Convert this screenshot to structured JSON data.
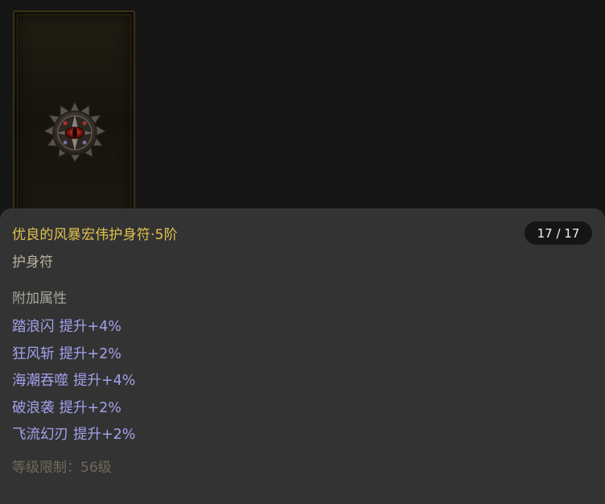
{
  "item": {
    "icon": "storm-amulet-icon",
    "name": "优良的风暴宏伟护身符·5阶",
    "type": "护身符",
    "counter": "17 / 17"
  },
  "attributes": {
    "title": "附加属性",
    "rows": [
      {
        "name": "踏浪闪",
        "value": "提升+4%"
      },
      {
        "name": "狂风斩",
        "value": "提升+2%"
      },
      {
        "name": "海潮吞噬",
        "value": "提升+4%"
      },
      {
        "name": "破浪袭",
        "value": "提升+2%"
      },
      {
        "name": "飞流幻刃",
        "value": "提升+2%"
      }
    ]
  },
  "requirement": "等级限制：56级",
  "colors": {
    "item_name": "#e3c24f",
    "attribute": "#a3a1ec",
    "panel": "#333333",
    "background": "#161616"
  }
}
